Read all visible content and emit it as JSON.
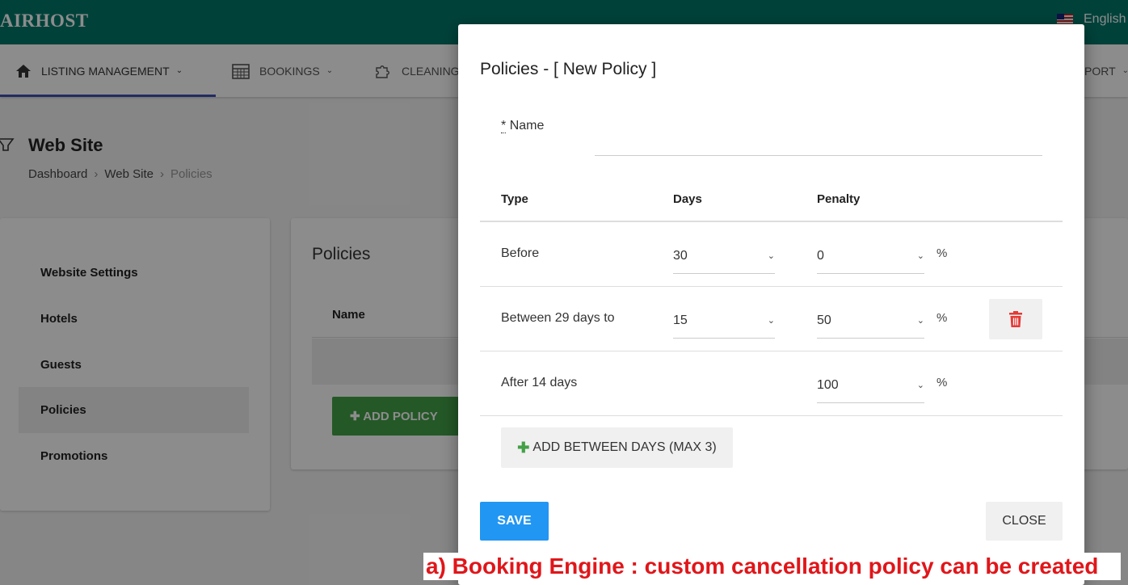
{
  "app": {
    "logo": "AIRHOST",
    "language": "English"
  },
  "nav": {
    "items": [
      {
        "label": "LISTING MANAGEMENT",
        "icon": "home-icon"
      },
      {
        "label": "BOOKINGS",
        "icon": "calendar-icon"
      },
      {
        "label": "CLEANING",
        "icon": "puzzle-icon"
      }
    ],
    "support": "PORT"
  },
  "page": {
    "title": "Web Site",
    "breadcrumb": [
      "Dashboard",
      "Web Site",
      "Policies"
    ]
  },
  "sidebar": {
    "items": [
      {
        "label": "Website Settings",
        "active": false
      },
      {
        "label": "Hotels",
        "active": false
      },
      {
        "label": "Guests",
        "active": false
      },
      {
        "label": "Policies",
        "active": true
      },
      {
        "label": "Promotions",
        "active": false
      }
    ]
  },
  "policies_card": {
    "title": "Policies",
    "column_name": "Name",
    "add_button": "ADD POLICY"
  },
  "modal": {
    "title": "Policies - [ New Policy ]",
    "name_label_req": "*",
    "name_label": "Name",
    "name_value": "",
    "columns": {
      "type": "Type",
      "days": "Days",
      "penalty": "Penalty"
    },
    "rows": [
      {
        "type": "Before",
        "days": "30",
        "penalty": "0",
        "unit": "%"
      },
      {
        "type": "Between 29 days to",
        "days": "15",
        "penalty": "50",
        "unit": "%"
      },
      {
        "type": "After 14 days",
        "days": "",
        "penalty": "100",
        "unit": "%"
      }
    ],
    "add_between_button": "ADD BETWEEN DAYS (MAX 3)",
    "save_button": "SAVE",
    "close_button": "CLOSE"
  },
  "caption": "a) Booking Engine : custom cancellation policy can be created",
  "colors": {
    "topbar": "#00796b",
    "save": "#2196f3",
    "add_policy": "#43a047",
    "delete_icon": "#e53935",
    "caption_text": "#e0161a"
  }
}
